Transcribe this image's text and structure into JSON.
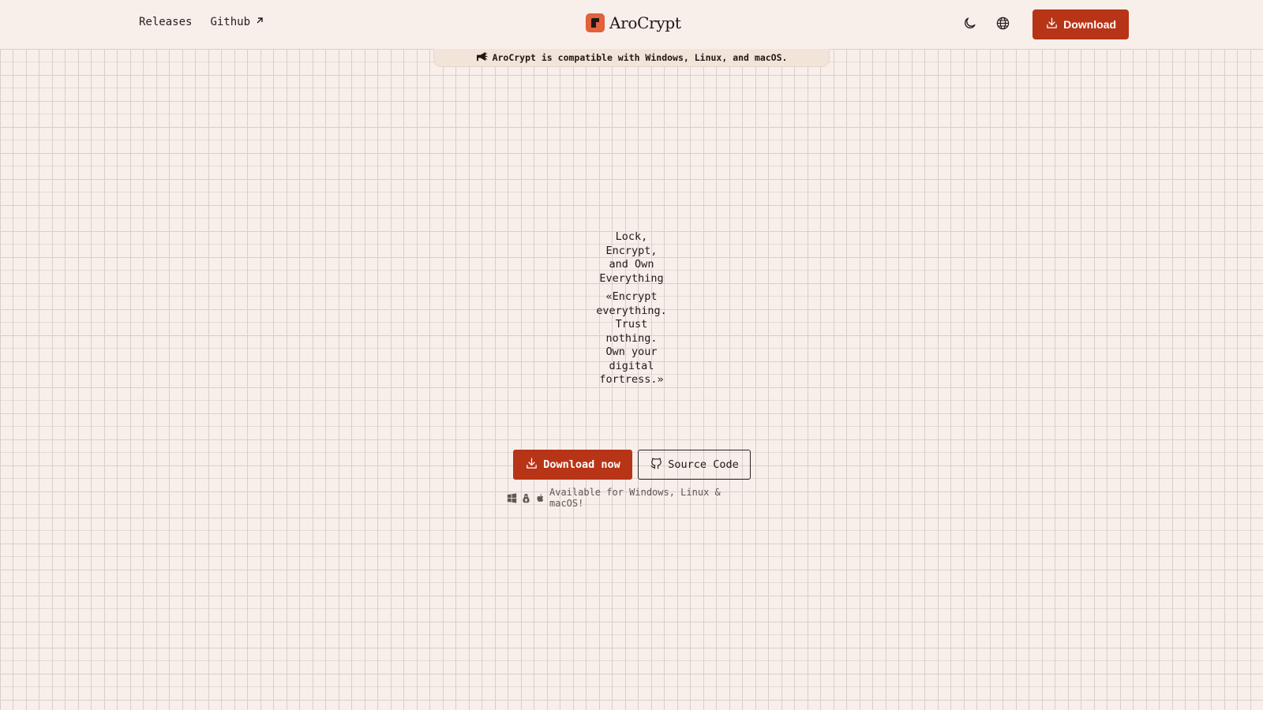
{
  "header": {
    "nav_left": [
      {
        "label": "Releases",
        "icon": null
      },
      {
        "label": "Github",
        "icon": "external-arrow-icon"
      }
    ],
    "brand": {
      "name": "AroCrypt",
      "logo_icon": "arocrypt-logo-icon"
    },
    "nav_right": {
      "theme_icon": "moon-icon",
      "language_icon": "globe-icon",
      "download_label": "Download"
    }
  },
  "banner": {
    "icon": "megaphone-icon",
    "text": "AroCrypt is compatible with Windows, Linux, and macOS."
  },
  "hero": {
    "title": "Lock, Encrypt, and Own Everything",
    "quote": "«Encrypt everything. Trust nothing. Own your digital fortress.»",
    "primary_button": "Download now",
    "secondary_button": "Source Code",
    "availability": "Available for Windows, Linux & macOS!",
    "os_icons": [
      "windows-icon",
      "linux-icon",
      "apple-icon"
    ]
  },
  "colors": {
    "background": "#f8efea",
    "accent": "#b83417",
    "logo": "#e2623c",
    "grid_line": "#d6cfca"
  }
}
